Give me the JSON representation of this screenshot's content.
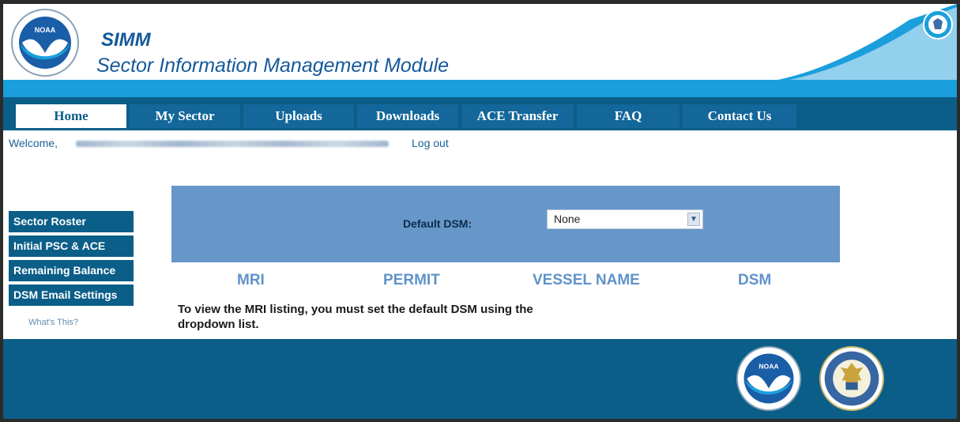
{
  "header": {
    "app_abbr": "SIMM",
    "app_name": "Sector Information Management Module",
    "logo_icon": "noaa-logo-icon",
    "seal_icon": "doc-seal-icon"
  },
  "nav": {
    "tabs": [
      {
        "label": "Home",
        "active": true
      },
      {
        "label": "My Sector",
        "active": false
      },
      {
        "label": "Uploads",
        "active": false
      },
      {
        "label": "Downloads",
        "active": false
      },
      {
        "label": "ACE Transfer",
        "active": false
      },
      {
        "label": "FAQ",
        "active": false
      },
      {
        "label": "Contact Us",
        "active": false
      }
    ]
  },
  "welcome": {
    "label": "Welcome,",
    "logout": "Log out"
  },
  "sidebar": {
    "items": [
      {
        "label": "Sector Roster"
      },
      {
        "label": "Initial PSC & ACE"
      },
      {
        "label": "Remaining Balance"
      },
      {
        "label": "DSM Email Settings"
      }
    ],
    "help_link": "What's This?"
  },
  "main": {
    "default_dsm_label": "Default DSM:",
    "default_dsm_value": "None",
    "columns": [
      "MRI",
      "PERMIT",
      "VESSEL NAME",
      "DSM"
    ],
    "message": "To view the MRI listing, you must set the default DSM using the dropdown list."
  },
  "footer": {
    "logos": [
      "noaa-logo-icon",
      "doc-seal-icon"
    ]
  },
  "colors": {
    "nav_bg": "#0a5e88",
    "accent_stripe": "#1a9fdc",
    "panel_bg": "#6797c9",
    "column_header": "#5f93c9",
    "title": "#14599b"
  }
}
